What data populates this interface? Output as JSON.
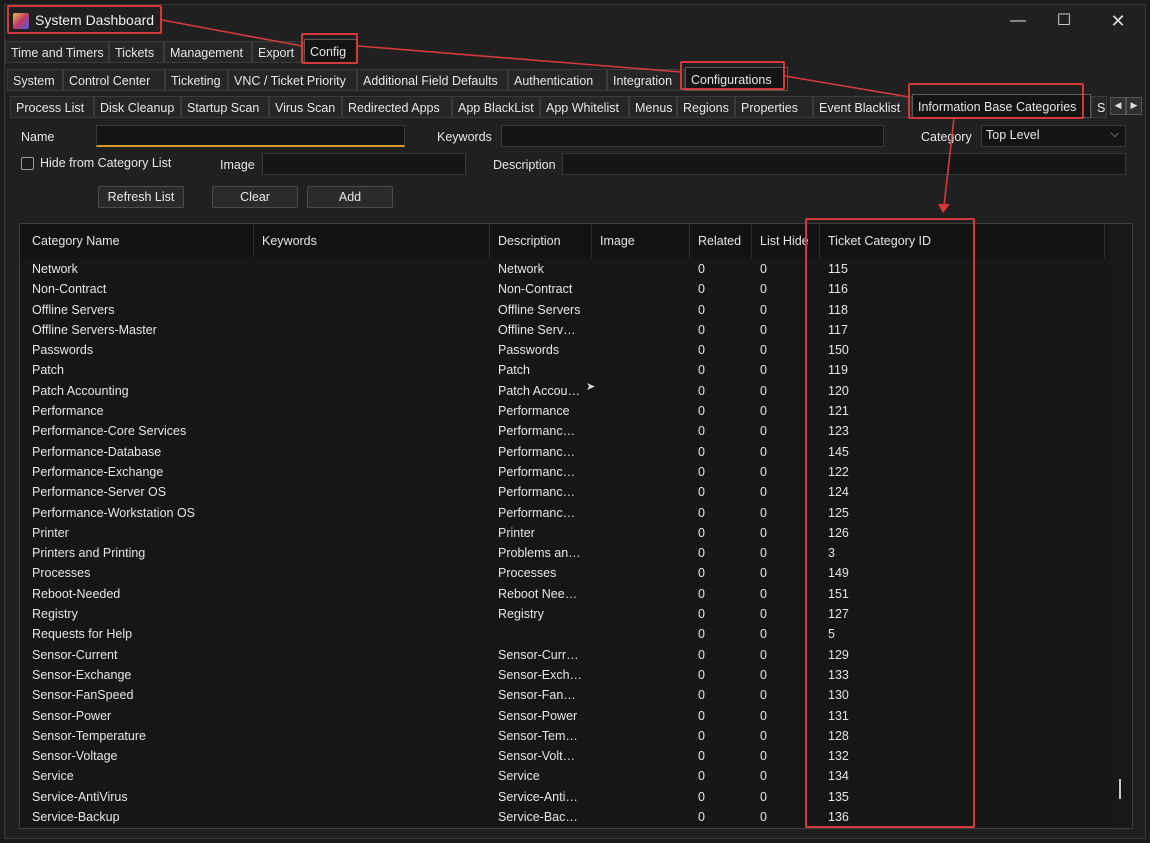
{
  "window": {
    "title": "System Dashboard",
    "controls": {
      "minimize": "—",
      "maximize": "☐",
      "close": "✕"
    }
  },
  "tabs_row1": [
    "Time and Timers",
    "Tickets",
    "Management",
    "Export",
    "Config"
  ],
  "tabs_row2": [
    "System",
    "Control Center",
    "Ticketing",
    "VNC / Ticket Priority",
    "Additional Field Defaults",
    "Authentication",
    "Integration",
    "Configurations"
  ],
  "tabs_row3": [
    "Process List",
    "Disk Cleanup",
    "Startup Scan",
    "Virus Scan",
    "Redirected Apps",
    "App BlackList",
    "App Whitelist",
    "Menus",
    "Regions",
    "Properties",
    "Event Blacklist",
    "Information Base Categories",
    "S"
  ],
  "tab_arrows": {
    "left": "◀",
    "right": "▶"
  },
  "form": {
    "name_label": "Name",
    "name_value": "",
    "keywords_label": "Keywords",
    "keywords_value": "",
    "category_label": "Category",
    "category_value": "Top Level",
    "hide_label": "Hide from Category List",
    "image_label": "Image",
    "image_value": "",
    "description_label": "Description",
    "description_value": "",
    "refresh_label": "Refresh List",
    "clear_label": "Clear",
    "add_label": "Add"
  },
  "table": {
    "headers": [
      "Category Name",
      "Keywords",
      "Description",
      "Image",
      "Related",
      "List Hide",
      "Ticket Category ID"
    ],
    "rows": [
      [
        "Network",
        "",
        "Network",
        "",
        "0",
        "0",
        "115"
      ],
      [
        "Non-Contract",
        "",
        "Non-Contract",
        "",
        "0",
        "0",
        "116"
      ],
      [
        "Offline Servers",
        "",
        "Offline Servers",
        "",
        "0",
        "0",
        "118"
      ],
      [
        "Offline Servers-Master",
        "",
        "Offline Serv…",
        "",
        "0",
        "0",
        "117"
      ],
      [
        "Passwords",
        "",
        "Passwords",
        "",
        "0",
        "0",
        "150"
      ],
      [
        "Patch",
        "",
        "Patch",
        "",
        "0",
        "0",
        "119"
      ],
      [
        "Patch Accounting",
        "",
        "Patch Accou…",
        "",
        "0",
        "0",
        "120"
      ],
      [
        "Performance",
        "",
        "Performance",
        "",
        "0",
        "0",
        "121"
      ],
      [
        "Performance-Core Services",
        "",
        "Performanc…",
        "",
        "0",
        "0",
        "123"
      ],
      [
        "Performance-Database",
        "",
        "Performanc…",
        "",
        "0",
        "0",
        "145"
      ],
      [
        "Performance-Exchange",
        "",
        "Performanc…",
        "",
        "0",
        "0",
        "122"
      ],
      [
        "Performance-Server OS",
        "",
        "Performanc…",
        "",
        "0",
        "0",
        "124"
      ],
      [
        "Performance-Workstation OS",
        "",
        "Performanc…",
        "",
        "0",
        "0",
        "125"
      ],
      [
        "Printer",
        "",
        "Printer",
        "",
        "0",
        "0",
        "126"
      ],
      [
        "Printers and Printing",
        "",
        "Problems an…",
        "",
        "0",
        "0",
        "3"
      ],
      [
        "Processes",
        "",
        "Processes",
        "",
        "0",
        "0",
        "149"
      ],
      [
        "Reboot-Needed",
        "",
        "Reboot Nee…",
        "",
        "0",
        "0",
        "151"
      ],
      [
        "Registry",
        "",
        "Registry",
        "",
        "0",
        "0",
        "127"
      ],
      [
        "Requests for Help",
        "",
        "",
        "",
        "0",
        "0",
        "5"
      ],
      [
        "Sensor-Current",
        "",
        "Sensor-Curr…",
        "",
        "0",
        "0",
        "129"
      ],
      [
        "Sensor-Exchange",
        "",
        "Sensor-Exch…",
        "",
        "0",
        "0",
        "133"
      ],
      [
        "Sensor-FanSpeed",
        "",
        "Sensor-Fan…",
        "",
        "0",
        "0",
        "130"
      ],
      [
        "Sensor-Power",
        "",
        "Sensor-Power",
        "",
        "0",
        "0",
        "131"
      ],
      [
        "Sensor-Temperature",
        "",
        "Sensor-Tem…",
        "",
        "0",
        "0",
        "128"
      ],
      [
        "Sensor-Voltage",
        "",
        "Sensor-Volt…",
        "",
        "0",
        "0",
        "132"
      ],
      [
        "Service",
        "",
        "Service",
        "",
        "0",
        "0",
        "134"
      ],
      [
        "Service-AntiVirus",
        "",
        "Service-Anti…",
        "",
        "0",
        "0",
        "135"
      ],
      [
        "Service-Backup",
        "",
        "Service-Bac…",
        "",
        "0",
        "0",
        "136"
      ]
    ]
  },
  "colors": {
    "highlight": "#d23a3a",
    "focus_underline": "#d39a2a",
    "background": "#202020"
  }
}
